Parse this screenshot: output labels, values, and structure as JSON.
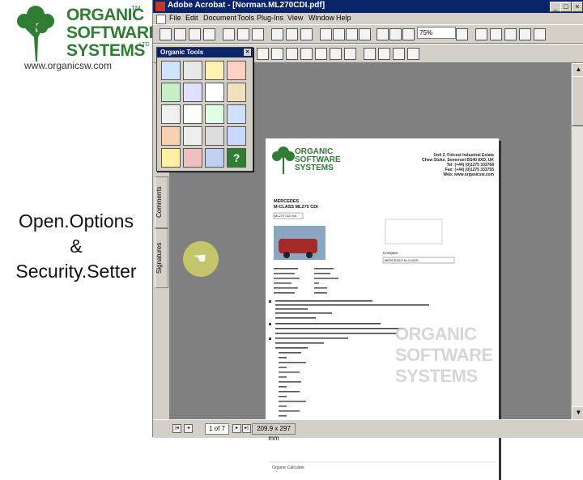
{
  "brand": {
    "name_line1": "ORGANIC",
    "name_line2": "SOFTWARE",
    "name_line3": "SYSTEMS",
    "tm": "TM",
    "ltd": "LTD",
    "url": "www.organicsw.com"
  },
  "caption": {
    "line1": "Open.Options",
    "line2": "&",
    "line3": "Security.Setter"
  },
  "window": {
    "title": "Adobe Acrobat - [Norman.ML270CDI.pdf]",
    "menu": [
      "File",
      "Edit",
      "Document",
      "Tools",
      "Plug-Ins",
      "View",
      "Window",
      "Help"
    ],
    "zoom": "75%",
    "side_tabs": [
      "Comments",
      "Signatures"
    ]
  },
  "palette": {
    "title": "Organic Tools",
    "close": "×"
  },
  "status": {
    "page": "1 of 7",
    "size": "209.9 x 297 mm"
  },
  "page": {
    "brand1": "ORGANIC",
    "brand2": "SOFTWARE",
    "brand3": "SYSTEMS",
    "address1": "Unit 2, Folcest Industrial Estate",
    "address2": "Chew Stoke, Somerset BS40 8XD, UK",
    "address3": "Tel: (+44) (0)1275 333768",
    "address4": "Fax: (+44) (0)1275 333755",
    "address5": "Web: www.organicsw.com",
    "make": "MERCEDES",
    "model": "M-CLASS ML270 CDI",
    "select": "ML270 CDI 5dr",
    "compare_label": "Compare",
    "compare_select": "MERCEDES M-CLASS",
    "footer": "Organic Calculate"
  },
  "watermark": {
    "line1": "ORGANIC",
    "line2": "SOFTWARE",
    "line3": "SYSTEMS"
  }
}
